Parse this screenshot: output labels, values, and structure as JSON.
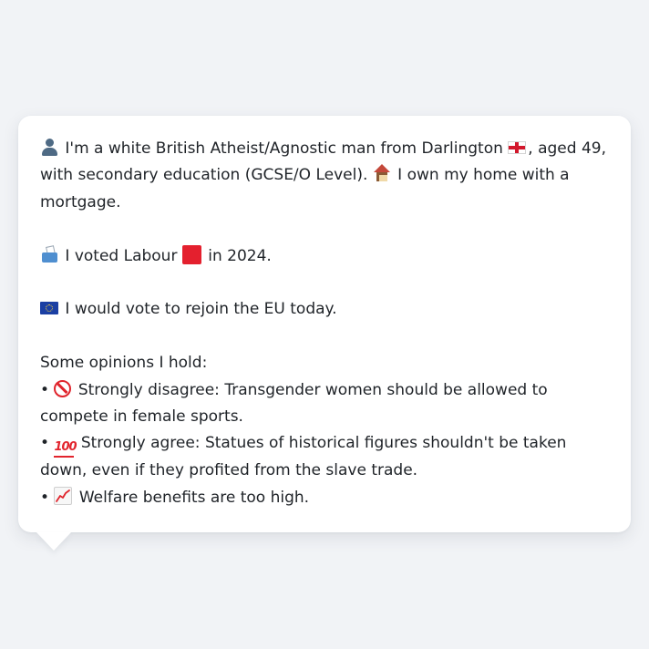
{
  "persona": {
    "intro": {
      "icon": "bust-in-silhouette-icon",
      "text_1": "I'm a white British Atheist/Agnostic man from Darlington",
      "flag_icon": "england-flag-icon",
      "text_2": ", aged 49, with secondary education (GCSE/O Level).",
      "home_icon": "house-icon",
      "text_3": "I own my home with a mortgage."
    },
    "vote": {
      "icon": "ballot-box-icon",
      "text_1": "I voted Labour",
      "party_icon": "red-square-icon",
      "text_2": "in 2024."
    },
    "eu": {
      "icon": "eu-flag-icon",
      "text": "I would vote to rejoin the EU today."
    },
    "opinions": {
      "heading": "Some opinions I hold:",
      "bullet": "•",
      "items": [
        {
          "icon": "prohibited-icon",
          "text": "Strongly disagree: Transgender women should be allowed to compete in female sports."
        },
        {
          "icon": "hundred-points-icon",
          "text": "Strongly agree: Statues of historical figures shouldn't be taken down, even if they profited from the slave trade."
        },
        {
          "icon": "chart-increasing-icon",
          "text": "Welfare benefits are too high."
        }
      ]
    }
  },
  "colors": {
    "background": "#f1f3f6",
    "bubble": "#ffffff",
    "text": "#1f2328"
  }
}
